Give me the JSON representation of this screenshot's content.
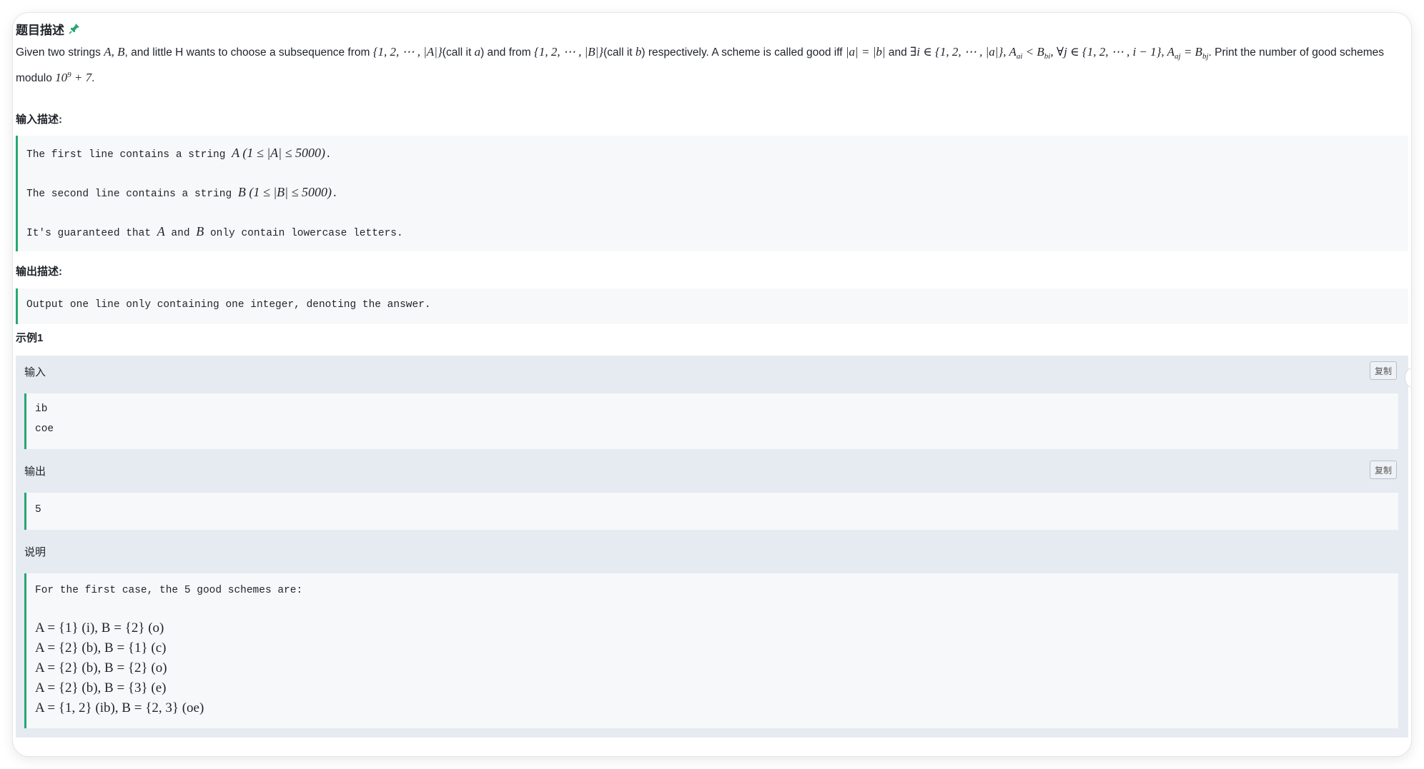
{
  "title": "题目描述",
  "description": {
    "part1": "Given two strings ",
    "m_AB": "A, B",
    "part2": ", and little H wants to choose a subsequence from ",
    "m_setA": "{1, 2, ⋯ , |A|}",
    "part3": "(call it ",
    "m_a": "a",
    "part4": ") and from ",
    "m_setB": "{1, 2, ⋯ , |B|}",
    "part5": "(call it ",
    "m_b": "b",
    "part6": ") respectively. A scheme is called good iff ",
    "m_cond1": "|a| = |b|",
    "part7": " and ",
    "m_cond2": "∃i ∈ {1, 2, ⋯ , |a|}, A",
    "m_cond2_sub": "ai",
    "m_cond3": " < B",
    "m_cond3_sub": "bi",
    "m_cond4": ", ∀j ∈ {1, 2, ⋯ , i − 1}, A",
    "m_cond4_sub": "aj",
    "m_cond5": " = B",
    "m_cond5_sub": "bj",
    "part8": ". Print the number of good schemes modulo ",
    "m_mod": "10",
    "m_mod_sup": "9",
    "m_mod2": " + 7",
    "part9": "."
  },
  "input_label": "输入描述:",
  "input_lines": [
    {
      "pre": "The first line contains a string ",
      "math": "A (1 ≤ |A| ≤ 5000)",
      "post": "."
    },
    {
      "pre": "The second line contains a string ",
      "math": "B (1 ≤ |B| ≤ 5000)",
      "post": "."
    },
    {
      "pre": "It's guaranteed that ",
      "math": "A",
      "mid": " and ",
      "math2": "B",
      "post": " only contain lowercase letters."
    }
  ],
  "output_label": "输出描述:",
  "output_line": "Output one line only containing one integer, denoting the answer.",
  "example_title": "示例1",
  "example": {
    "input_head": "输入",
    "copy_label": "复制",
    "input_lines": [
      "ib",
      "coe"
    ],
    "output_head": "输出",
    "output_value": "5",
    "explain_head": "说明",
    "explain_intro": "For the first case, the 5 good schemes are:",
    "schemes": [
      "A = {1} (i), B = {2} (o)",
      "A = {2} (b), B = {1} (c)",
      "A = {2} (b), B = {2} (o)",
      "A = {2} (b), B = {3} (e)",
      "A = {1, 2} (ib), B = {2, 3} (oe)"
    ]
  },
  "colors": {
    "accent": "#27a872",
    "panel_bg": "#e6ebf2",
    "code_bg": "#f7f8fa"
  }
}
